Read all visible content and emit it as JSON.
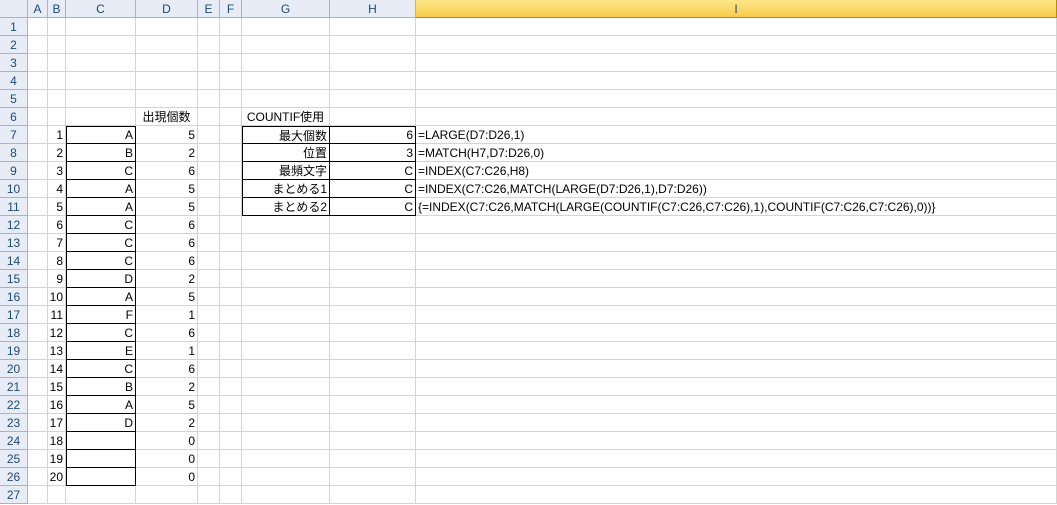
{
  "columns": [
    "A",
    "B",
    "C",
    "D",
    "E",
    "F",
    "G",
    "H",
    "I"
  ],
  "row_numbers": [
    1,
    2,
    3,
    4,
    5,
    6,
    7,
    8,
    9,
    10,
    11,
    12,
    13,
    14,
    15,
    16,
    17,
    18,
    19,
    20,
    21,
    22,
    23,
    24,
    25,
    26,
    27
  ],
  "selected_column": "I",
  "headers": {
    "D6": "出現個数",
    "G6": "COUNTIF使用",
    "G7": "最大個数",
    "G8": "位置",
    "G9": "最頻文字",
    "G10": "まとめる1",
    "G11": "まとめる2"
  },
  "series_b": [
    1,
    2,
    3,
    4,
    5,
    6,
    7,
    8,
    9,
    10,
    11,
    12,
    13,
    14,
    15,
    16,
    17,
    18,
    19,
    20
  ],
  "series_c": [
    "A",
    "B",
    "C",
    "A",
    "A",
    "C",
    "C",
    "C",
    "D",
    "A",
    "F",
    "C",
    "E",
    "C",
    "B",
    "A",
    "D",
    "",
    "",
    ""
  ],
  "series_d": [
    5,
    2,
    6,
    5,
    5,
    6,
    6,
    6,
    2,
    5,
    1,
    6,
    1,
    6,
    2,
    5,
    2,
    0,
    0,
    0
  ],
  "h_values": {
    "H7": "6",
    "H8": "3",
    "H9": "C",
    "H10": "C",
    "H11": "C"
  },
  "i_formulas": {
    "I7": "=LARGE(D7:D26,1)",
    "I8": "=MATCH(H7,D7:D26,0)",
    "I9": "=INDEX(C7:C26,H8)",
    "I10": "=INDEX(C7:C26,MATCH(LARGE(D7:D26,1),D7:D26))",
    "I11": "{=INDEX(C7:C26,MATCH(LARGE(COUNTIF(C7:C26,C7:C26),1),COUNTIF(C7:C26,C7:C26),0))}"
  }
}
